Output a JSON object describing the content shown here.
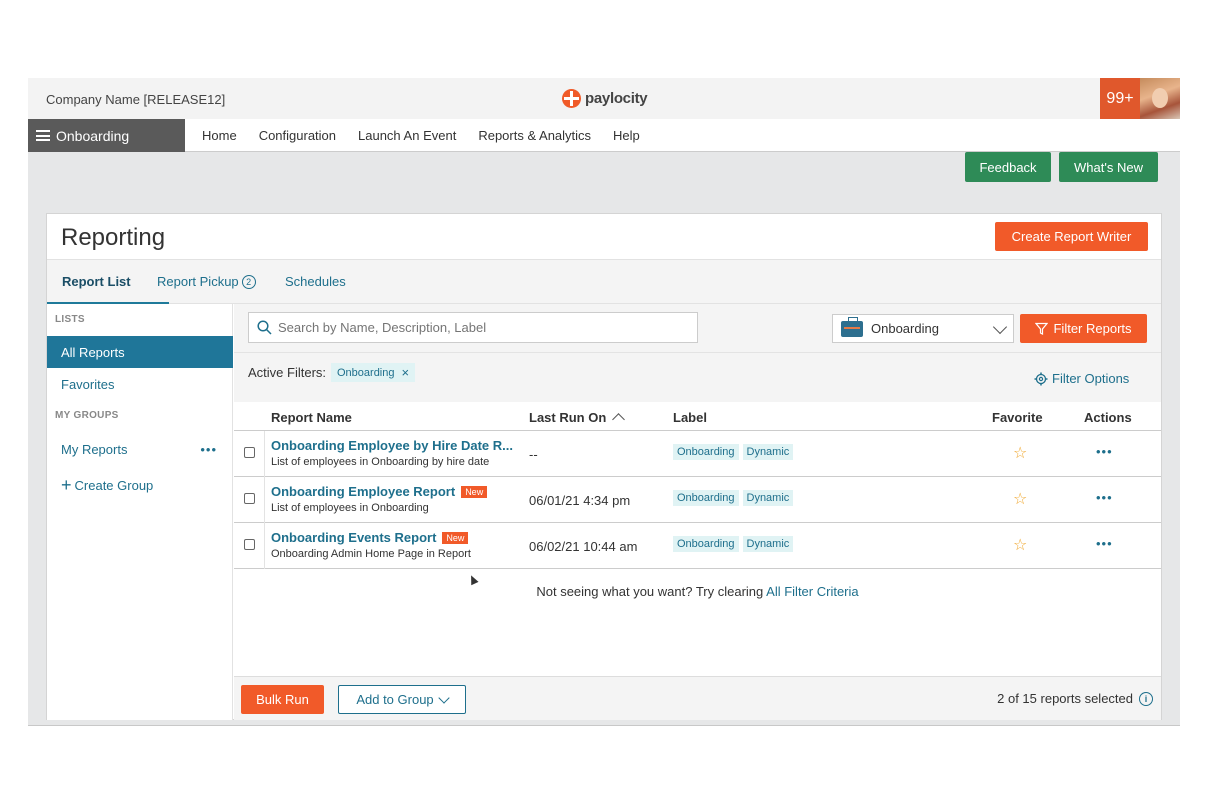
{
  "header": {
    "company": "Company Name [RELEASE12]",
    "brand": "paylocity",
    "notifications": "99+"
  },
  "nav": {
    "module": "Onboarding",
    "links": [
      "Home",
      "Configuration",
      "Launch An Event",
      "Reports & Analytics",
      "Help"
    ]
  },
  "actions": {
    "feedback": "Feedback",
    "whats_new": "What's New"
  },
  "page": {
    "title": "Reporting",
    "create_button": "Create Report Writer"
  },
  "tabs": [
    {
      "label": "Report List",
      "active": true
    },
    {
      "label": "Report Pickup",
      "badge": "2"
    },
    {
      "label": "Schedules"
    }
  ],
  "sidebar": {
    "lists_heading": "LISTS",
    "all_reports": "All Reports",
    "favorites": "Favorites",
    "groups_heading": "MY GROUPS",
    "my_reports": "My Reports",
    "my_reports_more": "•••",
    "create_group": "Create Group"
  },
  "toolbar": {
    "search_placeholder": "Search by Name, Description, Label",
    "module_selected": "Onboarding",
    "filter_button": "Filter Reports"
  },
  "filters": {
    "label": "Active Filters:",
    "chip": "Onboarding",
    "options_link": "Filter Options"
  },
  "table": {
    "columns": [
      "Report Name",
      "Last Run On",
      "Label",
      "Favorite",
      "Actions"
    ],
    "rows": [
      {
        "name": "Onboarding Employee by Hire Date R...",
        "description": "List of employees in Onboarding by hire date",
        "badge": "",
        "last_run": "--",
        "labels": [
          "Onboarding",
          "Dynamic"
        ],
        "actions": "•••"
      },
      {
        "name": "Onboarding Employee Report",
        "description": "List of employees in Onboarding",
        "badge": "New",
        "last_run": "06/01/21 4:34 pm",
        "labels": [
          "Onboarding",
          "Dynamic"
        ],
        "actions": "•••"
      },
      {
        "name": "Onboarding Events Report",
        "description": "Onboarding Admin Home Page in Report",
        "badge": "New",
        "last_run": "06/02/21 10:44 am",
        "labels": [
          "Onboarding",
          "Dynamic"
        ],
        "actions": "•••"
      }
    ],
    "empty_message": "Not seeing what you want? Try clearing",
    "empty_link": "All Filter Criteria"
  },
  "footer": {
    "bulk_run": "Bulk Run",
    "add_to_group": "Add to Group",
    "selected_count": "2 of 15 reports selected"
  },
  "colors": {
    "accent_orange": "#f15a29",
    "accent_green": "#2e8b57",
    "link_blue": "#1e6f8c"
  }
}
